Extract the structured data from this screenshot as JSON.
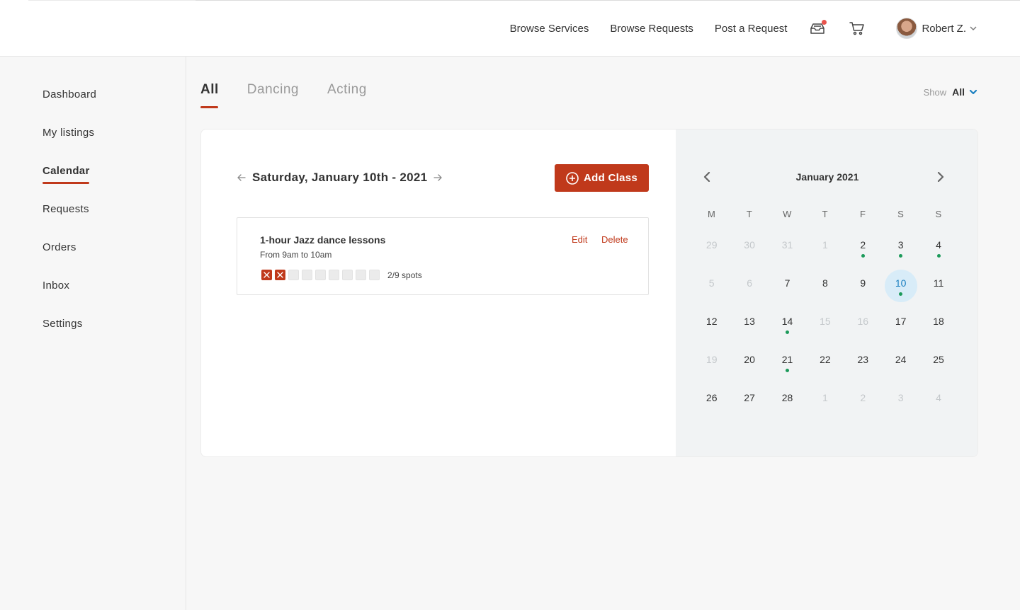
{
  "nav": {
    "links": [
      "Browse Services",
      "Browse Requests",
      "Post a Request"
    ],
    "user_name": "Robert Z.",
    "icons": [
      "inbox-icon",
      "cart-icon"
    ]
  },
  "sidebar": {
    "items": [
      {
        "label": "Dashboard"
      },
      {
        "label": "My listings"
      },
      {
        "label": "Calendar",
        "active": true
      },
      {
        "label": "Requests"
      },
      {
        "label": "Orders"
      },
      {
        "label": "Inbox"
      },
      {
        "label": "Settings"
      }
    ]
  },
  "tabs": [
    {
      "label": "All",
      "active": true
    },
    {
      "label": "Dancing"
    },
    {
      "label": "Acting"
    }
  ],
  "show": {
    "label": "Show",
    "value": "All"
  },
  "schedule": {
    "date_title": "Saturday, January 10th - 2021",
    "add_label": "Add Class",
    "event": {
      "title": "1-hour Jazz dance lessons",
      "time": "From 9am to 10am",
      "edit_label": "Edit",
      "delete_label": "Delete",
      "spots_taken": 2,
      "spots_total": 9,
      "spots_label": "2/9 spots"
    }
  },
  "calendar": {
    "title": "January 2021",
    "weekdays": [
      "M",
      "T",
      "W",
      "T",
      "F",
      "S",
      "S"
    ],
    "weeks": [
      [
        {
          "d": "29",
          "muted": true
        },
        {
          "d": "30",
          "muted": true
        },
        {
          "d": "31",
          "muted": true
        },
        {
          "d": "1",
          "muted": true
        },
        {
          "d": "2",
          "dot": true
        },
        {
          "d": "3",
          "dot": true
        },
        {
          "d": "4",
          "dot": true
        }
      ],
      [
        {
          "d": "5",
          "muted": true
        },
        {
          "d": "6",
          "muted": true
        },
        {
          "d": "7"
        },
        {
          "d": "8"
        },
        {
          "d": "9"
        },
        {
          "d": "10",
          "dot": true,
          "selected": true
        },
        {
          "d": "11"
        }
      ],
      [
        {
          "d": "12"
        },
        {
          "d": "13"
        },
        {
          "d": "14",
          "dot": true
        },
        {
          "d": "15",
          "muted": true
        },
        {
          "d": "16",
          "muted": true
        },
        {
          "d": "17"
        },
        {
          "d": "18"
        }
      ],
      [
        {
          "d": "19",
          "muted": true
        },
        {
          "d": "20"
        },
        {
          "d": "21",
          "dot": true
        },
        {
          "d": "22"
        },
        {
          "d": "23"
        },
        {
          "d": "24"
        },
        {
          "d": "25"
        }
      ],
      [
        {
          "d": "26"
        },
        {
          "d": "27"
        },
        {
          "d": "28"
        },
        {
          "d": "1",
          "muted": true
        },
        {
          "d": "2",
          "muted": true
        },
        {
          "d": "3",
          "muted": true
        },
        {
          "d": "4",
          "muted": true
        }
      ]
    ]
  },
  "colors": {
    "accent": "#c0391b",
    "event_dot": "#1c9a5a",
    "selected_bg": "#d8ecf8",
    "selected_text": "#1a7fc0",
    "notification": "#e8534c"
  }
}
